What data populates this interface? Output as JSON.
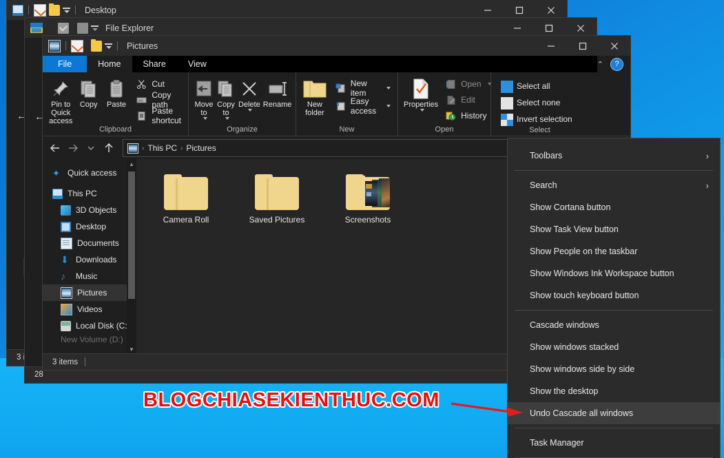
{
  "desktop": {
    "watermark": "BLOGCHIASEKIENTHUC.COM"
  },
  "windows": {
    "back": {
      "title": "Desktop"
    },
    "middle": {
      "title": "File Explorer"
    },
    "front": {
      "title": "Pictures",
      "controls": {
        "minimize": "—",
        "maximize": "□",
        "close": "✕"
      },
      "tabs": [
        {
          "label": "File",
          "active": true
        },
        {
          "label": "Home",
          "active": false
        },
        {
          "label": "Share",
          "active": false
        },
        {
          "label": "View",
          "active": false
        }
      ],
      "help_label": "?",
      "collapse_label": "⌃",
      "ribbon": {
        "groups": [
          {
            "name": "Clipboard",
            "big_buttons": [
              {
                "label": "Pin to Quick access",
                "icon": "pin-icon"
              },
              {
                "label": "Copy",
                "icon": "copy-icon"
              },
              {
                "label": "Paste",
                "icon": "paste-icon"
              }
            ],
            "small_buttons": [
              {
                "label": "Cut",
                "icon": "scissors-icon"
              },
              {
                "label": "Copy path",
                "icon": "copy-path-icon"
              },
              {
                "label": "Paste shortcut",
                "icon": "paste-shortcut-icon"
              }
            ]
          },
          {
            "name": "Organize",
            "big_buttons": [
              {
                "label": "Move to",
                "icon": "move-to-icon",
                "dropdown": true
              },
              {
                "label": "Copy to",
                "icon": "copy-to-icon",
                "dropdown": true
              },
              {
                "label": "Delete",
                "icon": "delete-icon",
                "dropdown": true
              },
              {
                "label": "Rename",
                "icon": "rename-icon"
              }
            ],
            "small_buttons": []
          },
          {
            "name": "New",
            "big_buttons": [
              {
                "label": "New folder",
                "icon": "new-folder-icon"
              }
            ],
            "small_buttons": [
              {
                "label": "New item",
                "icon": "new-item-icon",
                "dropdown": true
              },
              {
                "label": "Easy access",
                "icon": "easy-access-icon",
                "dropdown": true
              }
            ]
          },
          {
            "name": "Open",
            "big_buttons": [
              {
                "label": "Properties",
                "icon": "properties-icon",
                "dropdown": true
              }
            ],
            "small_buttons": [
              {
                "label": "Open",
                "icon": "open-icon",
                "dropdown": true,
                "disabled": true
              },
              {
                "label": "Edit",
                "icon": "edit-icon",
                "disabled": true
              },
              {
                "label": "History",
                "icon": "history-icon"
              }
            ]
          },
          {
            "name": "Select",
            "big_buttons": [],
            "small_buttons": [
              {
                "label": "Select all",
                "icon": "select-all-icon"
              },
              {
                "label": "Select none",
                "icon": "select-none-icon"
              },
              {
                "label": "Invert selection",
                "icon": "invert-selection-icon"
              }
            ]
          }
        ]
      },
      "address": {
        "back_icon": "←",
        "forward_icon": "→",
        "recent_icon": "⌄",
        "up_icon": "↑",
        "breadcrumbs": [
          "This PC",
          "Pictures"
        ],
        "separator": "›",
        "dropdown_icon": "⌄"
      },
      "nav_pane": {
        "items": [
          {
            "label": "Quick access",
            "icon": "star-icon",
            "indent": false,
            "selected": false
          },
          {
            "label": "This PC",
            "icon": "pc-icon",
            "indent": false,
            "selected": false
          },
          {
            "label": "3D Objects",
            "icon": "3d-objects-icon",
            "indent": true,
            "selected": false
          },
          {
            "label": "Desktop",
            "icon": "desktop-icon",
            "indent": true,
            "selected": false
          },
          {
            "label": "Documents",
            "icon": "documents-icon",
            "indent": true,
            "selected": false
          },
          {
            "label": "Downloads",
            "icon": "downloads-icon",
            "indent": true,
            "selected": false
          },
          {
            "label": "Music",
            "icon": "music-icon",
            "indent": true,
            "selected": false
          },
          {
            "label": "Pictures",
            "icon": "pictures-icon",
            "indent": true,
            "selected": true
          },
          {
            "label": "Videos",
            "icon": "videos-icon",
            "indent": true,
            "selected": false
          },
          {
            "label": "Local Disk (C:)",
            "icon": "disk-icon",
            "indent": true,
            "selected": false
          }
        ],
        "clipped_item": "New Volume (D:)"
      },
      "files": [
        {
          "name": "Camera Roll",
          "type": "folder"
        },
        {
          "name": "Saved Pictures",
          "type": "folder"
        },
        {
          "name": "Screenshots",
          "type": "folder-with-preview"
        }
      ],
      "status": {
        "count": "3 items"
      }
    }
  },
  "context_menu": {
    "groups": [
      [
        {
          "label": "Toolbars",
          "submenu": true,
          "highlighted": false
        }
      ],
      [
        {
          "label": "Search",
          "submenu": true,
          "highlighted": false
        },
        {
          "label": "Show Cortana button",
          "submenu": false,
          "highlighted": false
        },
        {
          "label": "Show Task View button",
          "submenu": false,
          "highlighted": false
        },
        {
          "label": "Show People on the taskbar",
          "submenu": false,
          "highlighted": false
        },
        {
          "label": "Show Windows Ink Workspace button",
          "submenu": false,
          "highlighted": false
        },
        {
          "label": "Show touch keyboard button",
          "submenu": false,
          "highlighted": false
        }
      ],
      [
        {
          "label": "Cascade windows",
          "submenu": false,
          "highlighted": false
        },
        {
          "label": "Show windows stacked",
          "submenu": false,
          "highlighted": false
        },
        {
          "label": "Show windows side by side",
          "submenu": false,
          "highlighted": false
        },
        {
          "label": "Show the desktop",
          "submenu": false,
          "highlighted": false
        },
        {
          "label": "Undo Cascade all windows",
          "submenu": false,
          "highlighted": true
        }
      ],
      [
        {
          "label": "Task Manager",
          "submenu": false,
          "highlighted": false
        }
      ]
    ],
    "submenu_arrow": "›"
  },
  "colors": {
    "accent_blue": "#0a78d4",
    "desktop_blue": "#0f9ae8",
    "window_bg": "#1f1f1f",
    "titlebar_bg": "#2b2b2b",
    "menu_bg": "#2b2b2b",
    "highlight": "#3d3d3d",
    "watermark_red": "#e8100f",
    "arrow_red": "#e01d1d",
    "folder_yellow": "#f0d58c"
  }
}
